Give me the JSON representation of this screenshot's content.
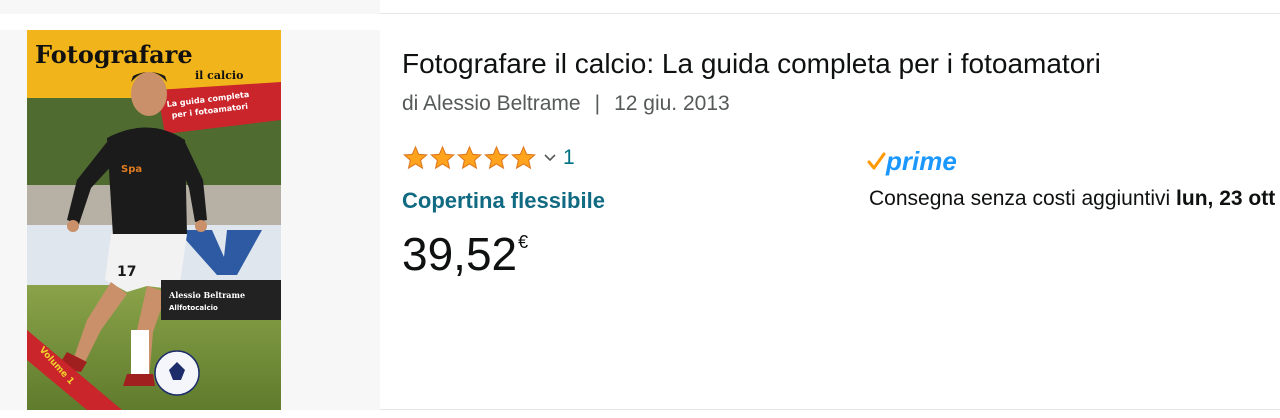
{
  "product": {
    "title": "Fotografare il calcio: La guida completa per i fotoamatori",
    "author_prefix": "di",
    "author": "Alessio Beltrame",
    "separator": "|",
    "date": "12 giu. 2013",
    "rating": {
      "stars": 5,
      "max_stars": 5,
      "count": "1"
    },
    "format": "Copertina flessibile",
    "price": {
      "whole": "39,52",
      "currency": "€"
    },
    "prime_label": "prime",
    "delivery": {
      "text": "Consegna senza costi aggiuntivi",
      "date_strong": "lun, 23 ott"
    }
  },
  "cover": {
    "title_main": "Fotografare",
    "title_sub": "il calcio",
    "subtitle_line1": "La guida completa",
    "subtitle_line2": "per i fotoamatori",
    "author_name": "Alessio Beltrame",
    "author_tag": "Allfotocalcio",
    "volume": "Volume 1",
    "jersey_number": "17",
    "shirt_sponsor": "Spa"
  },
  "colors": {
    "star": "#ffa41c",
    "link": "#007185",
    "format": "#0f6a82",
    "prime_blue": "#1a98ff",
    "prime_check": "#ff9900"
  }
}
